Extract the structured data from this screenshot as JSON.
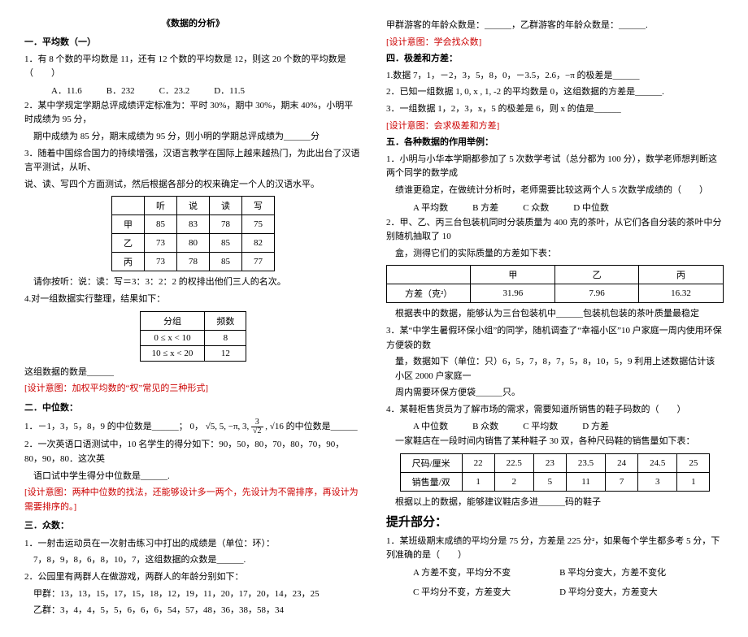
{
  "title": "《数据的分析》",
  "left": {
    "sec1_head": "一．平均数（一）",
    "q1": "1．有 8 个数的平均数是 11，还有 12 个数的平均数是 12，则这 20 个数的平均数是（　　）",
    "q1_opts": {
      "a": "A．11.6",
      "b": "B．232",
      "c": "C．23.2",
      "d": "D．11.5"
    },
    "q2a": "2．某中学规定学期总评成绩评定标准为：平时 30%，期中 30%，期末 40%，小明平时成绩为 95 分，",
    "q2b": "期中成绩为 85 分，期末成绩为 95 分，则小明的学期总评成绩为______分",
    "q3a": "3．随着中国综合国力的持续增强，汉语言教学在国际上越来越热门，为此出台了汉语言平测试，从听、",
    "q3b": "说、读、写四个方面测试，然后根据各部分的权来确定一个人的汉语水平。",
    "table1": {
      "head": [
        "",
        "听",
        "说",
        "读",
        "写"
      ],
      "rows": [
        [
          "甲",
          "85",
          "83",
          "78",
          "75"
        ],
        [
          "乙",
          "73",
          "80",
          "85",
          "82"
        ],
        [
          "丙",
          "73",
          "78",
          "85",
          "77"
        ]
      ]
    },
    "q3c": "请你按听：说：读：写＝3：3：2：2 的权排出他们三人的名次。",
    "q4a": "4.对一组数据实行整理，结果如下：",
    "table2": {
      "head": [
        "分组",
        "频数"
      ],
      "rows": [
        [
          "0 ≤ x < 10",
          "8"
        ],
        [
          "10 ≤ x < 20",
          "12"
        ]
      ]
    },
    "q4b": "这组数据的数是______",
    "design1": "[设计意图：加权平均数的“权”常见的三种形式]",
    "sec2_head": "二．中位数：",
    "q2_1a": "1．－1，3，5，8，9 的中位数是______；",
    "q2_1b_prefix": "0，",
    "q2_1b_list": "√5, 5, −π, 3, ",
    "q2_1b_tail": ", √16 的中位数是______",
    "q2_2a": "2．一次英语口语测试中，10 名学生的得分如下：90，50，80，70，80，70，90，80，90，80．这次英",
    "q2_2b": "语口试中学生得分中位数是______.",
    "design2": "[设计意图：两种中位数的找法，还能够设计多一两个，先设计为不需排序，再设计为需要排序的。]",
    "sec3_head": "三．众数：",
    "q3_1a": "1．一射击运动员在一次射击练习中打出的成绩是（单位：环）：",
    "q3_1b": "7，8，9，8，6，8，10，7，这组数据的众数是______.",
    "q3_2a": "2．公园里有两群人在做游戏，两群人的年龄分别如下：",
    "q3_2b": "甲群：13，13，15，17，15，18，12，19，11，20，17，20，14，23，25",
    "q3_2c": "乙群：3，4，4，5，5，6，6，6，54，57，48，36，38，58，34"
  },
  "right": {
    "r1": "甲群游客的年龄众数是：______，乙群游客的年龄众数是：______.",
    "design3": "[设计意图：学会找众数]",
    "sec4_head": "四．极差和方差：",
    "q4_1": "1.数据 7，1，－2，3，5，8，0，－3.5，2.6，−π 的极差是______",
    "q4_2": "2．已知一组数据 1, 0, x , 1, -2 的平均数是 0，这组数据的方差是______.",
    "q4_3": "3．一组数据 1，2，3，x，5 的极差是 6，则 x 的值是______",
    "design4": "[设计意图：会求极差和方差]",
    "sec5_head": "五．各种数据的作用举例：",
    "q5_1a": "1．小明与小华本学期都参加了 5 次数学考试（总分都为 100 分），数学老师想判断这两个同学的数学成",
    "q5_1b": "绩谁更稳定，在做统计分析时，老师需要比较这两个人 5 次数学成绩的（　　）",
    "q5_1_opts": {
      "a": "A 平均数",
      "b": "B 方差",
      "c": "C 众数",
      "d": "D 中位数"
    },
    "q5_2a": "2．甲、乙、丙三台包装机同时分装质量为 400 克的茶叶，从它们各自分装的茶叶中分别随机抽取了 10",
    "q5_2b": "盒，测得它们的实际质量的方差如下表：",
    "table3": {
      "head": [
        "",
        "甲",
        "乙",
        "丙"
      ],
      "rows": [
        [
          "方差（克²）",
          "31.96",
          "7.96",
          "16.32"
        ]
      ]
    },
    "q5_2c": "根据表中的数据，能够认为三台包装机中______包装机包装的茶叶质量最稳定",
    "q5_3a": "3．某“中学生暑假环保小组”的同学，随机调查了“幸福小区”10 户家庭一周内使用环保方便袋的数",
    "q5_3b": "量，数据如下（单位：只）6，5，7，8，7，5，8，10，5，9 利用上述数据估计该小区 2000 户家庭一",
    "q5_3c": "周内需要环保方便袋______只。",
    "q5_4a": "4．某鞋柜售货员为了解市场的需求，需要知道所销售的鞋子码数的（　　）",
    "q5_4_opts": {
      "a": "A 中位数",
      "b": "B 众数",
      "c": "C 平均数",
      "d": "D 方差"
    },
    "q5_4b": "一家鞋店在一段时间内销售了某种鞋子 30 双，各种尺码鞋的销售量如下表：",
    "table4": {
      "head": [
        "尺码/厘米",
        "22",
        "22.5",
        "23",
        "23.5",
        "24",
        "24.5",
        "25"
      ],
      "rows": [
        [
          "销售量/双",
          "1",
          "2",
          "5",
          "11",
          "7",
          "3",
          "1"
        ]
      ]
    },
    "q5_4c": "根据以上的数据，能够建议鞋店多进______码的鞋子",
    "sec6_head": "提升部分：",
    "q6_1a": "1．某班级期末成绩的平均分是 75 分，方差是 225 分²，如果每个学生都多考 5 分，下列准确的是（　　）",
    "q6_1_opts": {
      "a": "A 方差不变，平均分不变",
      "b": "B 平均分变大，方差不变化",
      "c": "C 平均分不变，方差变大",
      "d": "D 平均分变大，方差变大"
    }
  }
}
